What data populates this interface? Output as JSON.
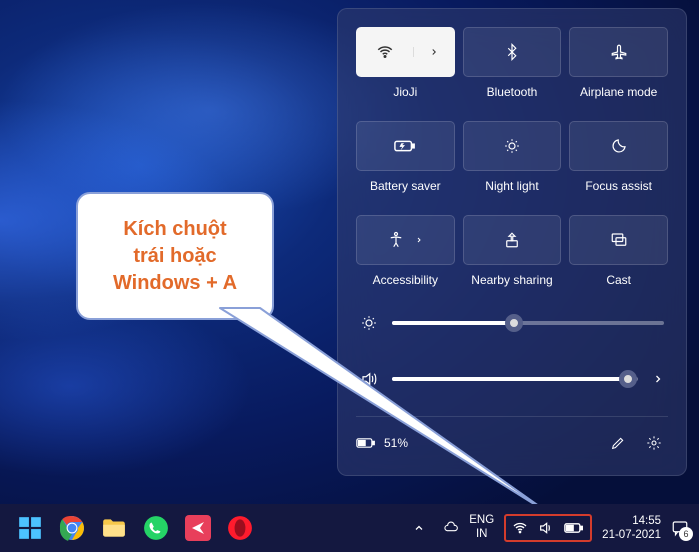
{
  "callout": {
    "line1": "Kích chuột",
    "line2": "trái hoặc",
    "line3": "Windows + A"
  },
  "panel": {
    "tiles": [
      {
        "id": "wifi",
        "label": "JioJi",
        "active": true,
        "hasChevron": true
      },
      {
        "id": "bluetooth",
        "label": "Bluetooth",
        "active": false
      },
      {
        "id": "airplane",
        "label": "Airplane mode",
        "active": false
      },
      {
        "id": "batterysaver",
        "label": "Battery saver",
        "active": false
      },
      {
        "id": "nightlight",
        "label": "Night light",
        "active": false
      },
      {
        "id": "focus",
        "label": "Focus assist",
        "active": false
      },
      {
        "id": "accessibility",
        "label": "Accessibility",
        "active": false,
        "hasChevron": true
      },
      {
        "id": "nearby",
        "label": "Nearby sharing",
        "active": false
      },
      {
        "id": "cast",
        "label": "Cast",
        "active": false
      }
    ],
    "brightness": 45,
    "volume": 96,
    "battery_text": "51%"
  },
  "taskbar": {
    "apps": [
      {
        "name": "start",
        "color": "#3a8"
      },
      {
        "name": "chrome"
      },
      {
        "name": "files",
        "color": "#f7c84a"
      },
      {
        "name": "whatsapp",
        "color": "#25d366"
      },
      {
        "name": "send",
        "color": "#e83f5b"
      },
      {
        "name": "opera",
        "color": "#ff1b2d"
      }
    ],
    "chevron": "ᐱ",
    "onedrive": "☁",
    "lang1": "ENG",
    "lang2": "IN",
    "time": "14:55",
    "date": "21-07-2021",
    "notif_count": "6"
  }
}
